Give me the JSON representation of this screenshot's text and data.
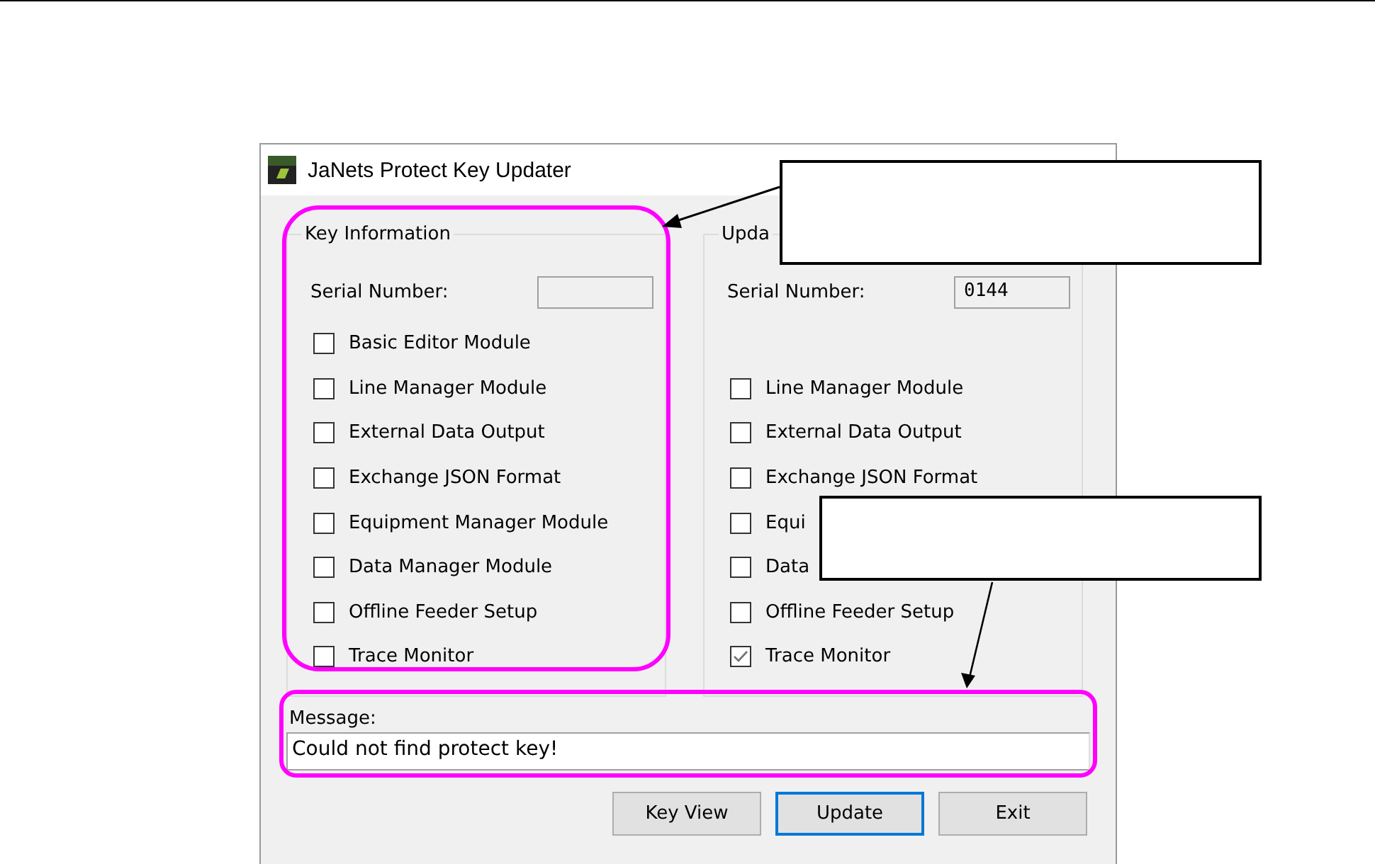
{
  "window": {
    "title": "JaNets Protect Key Updater"
  },
  "groups": [
    {
      "title": "Key Information",
      "serial_label": "Serial Number:",
      "options": [
        {
          "kind": "checkbox",
          "label": "Basic Editor Module",
          "checked": false
        },
        {
          "kind": "checkbox",
          "label": "Line Manager Module",
          "checked": false
        },
        {
          "kind": "checkbox",
          "label": "External Data Output",
          "checked": false
        },
        {
          "kind": "checkbox",
          "label": "Exchange JSON Format",
          "checked": false
        },
        {
          "kind": "checkbox",
          "label": "Equipment Manager Module",
          "checked": false
        },
        {
          "kind": "checkbox",
          "label": "Data Manager Module",
          "checked": false
        },
        {
          "kind": "checkbox",
          "label": "Offline Feeder Setup",
          "checked": false
        },
        {
          "kind": "checkbox",
          "label": "Trace Monitor",
          "checked": false
        }
      ]
    },
    {
      "title": "Upda",
      "serial_label": "Serial Number:",
      "serial_value": "0144",
      "options": [
        {
          "kind": "blank"
        },
        {
          "kind": "checkbox",
          "label": "Line Manager Module",
          "checked": false
        },
        {
          "kind": "checkbox",
          "label": "External Data Output",
          "checked": false
        },
        {
          "kind": "checkbox",
          "label": "Exchange JSON Format",
          "checked": false
        },
        {
          "kind": "checkbox",
          "label": "Equi",
          "checked": false
        },
        {
          "kind": "checkbox",
          "label": "Data",
          "checked": false
        },
        {
          "kind": "checkbox",
          "label": "Offline Feeder Setup",
          "checked": false
        },
        {
          "kind": "checkbox",
          "label": "Trace Monitor",
          "checked": true
        }
      ]
    }
  ],
  "message": {
    "label": "Message:",
    "value": "Could not find protect key!"
  },
  "buttons": [
    {
      "label": "Key View",
      "default": false
    },
    {
      "label": "Update",
      "default": true
    },
    {
      "label": "Exit",
      "default": false
    }
  ]
}
